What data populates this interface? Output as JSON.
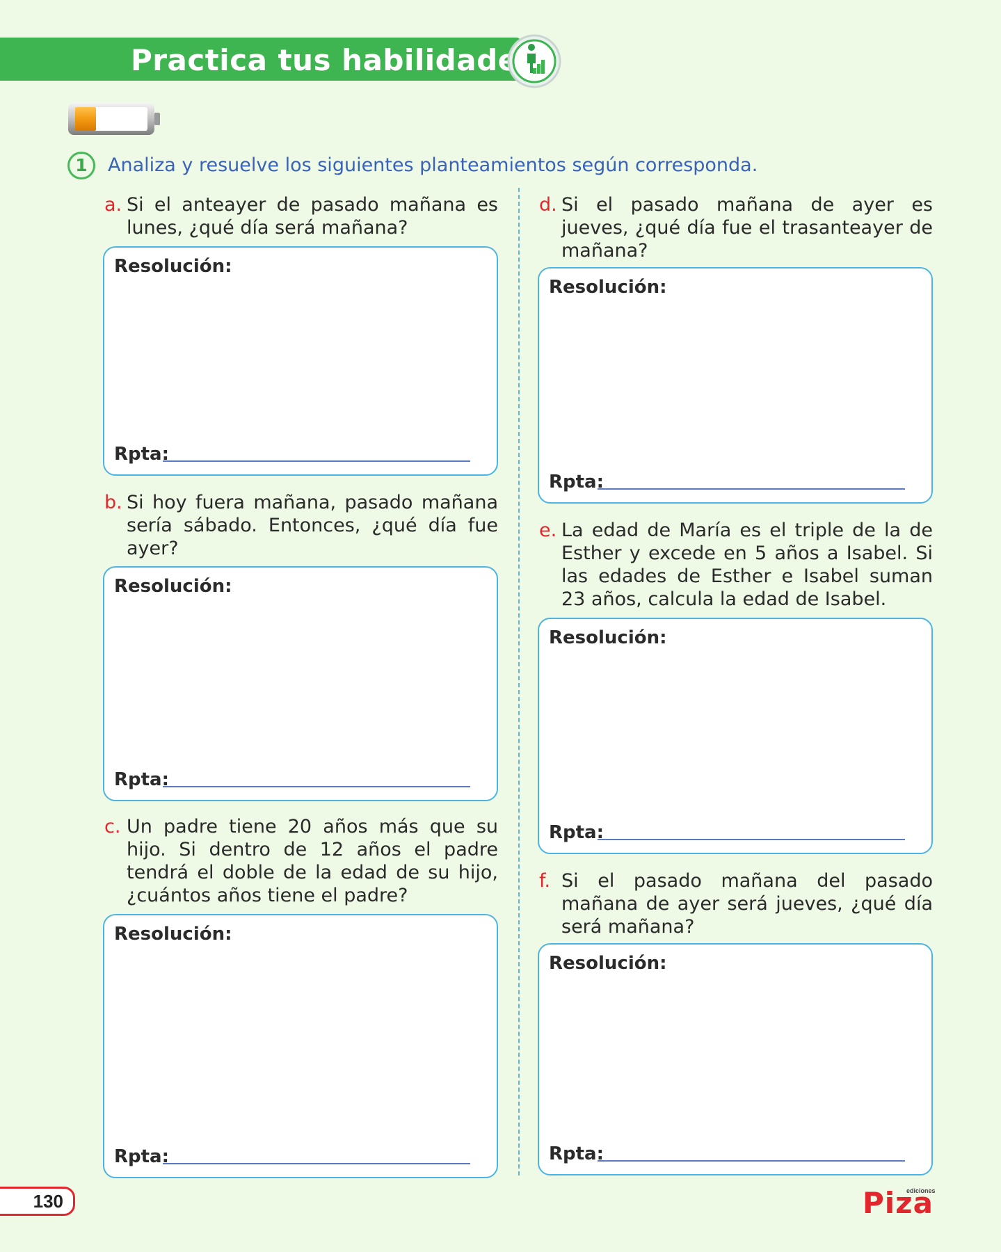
{
  "header": {
    "title": "Practica tus habilidades",
    "badge_icon": "climbing-stairs-icon",
    "accent": "#3fb552"
  },
  "battery_icon": "battery-low-icon",
  "instruction": {
    "number": "1",
    "text": "Analiza y resuelve los siguientes planteamientos según corresponda."
  },
  "labels": {
    "resolution": "Resolución:",
    "answer": "Rpta:"
  },
  "problems": [
    {
      "letter": "a.",
      "text": "Si el anteayer de pasado mañana es lunes, ¿qué día será mañana?"
    },
    {
      "letter": "b.",
      "text": "Si hoy fuera mañana, pasado mañana sería sábado. Entonces, ¿qué día fue ayer?"
    },
    {
      "letter": "c.",
      "text": "Un padre tiene 20 años más que su hijo. Si dentro de 12 años el padre tendrá el doble de la edad de su hijo, ¿cuántos años tiene el padre?"
    },
    {
      "letter": "d.",
      "text": "Si el pasado mañana de ayer es jueves, ¿qué día fue el trasanteayer de mañana?"
    },
    {
      "letter": "e.",
      "text": "La edad de María es el triple de la de Esther y excede en 5 años a Isabel. Si las edades de Esther e Isabel suman 23 años, calcula la edad de Isabel."
    },
    {
      "letter": "f.",
      "text": "Si el pasado mañana del pasado mañana de ayer será jueves, ¿qué día será mañana?"
    }
  ],
  "footer": {
    "page_number": "130",
    "logo_main": "Piza",
    "logo_sub": "ediciones"
  }
}
